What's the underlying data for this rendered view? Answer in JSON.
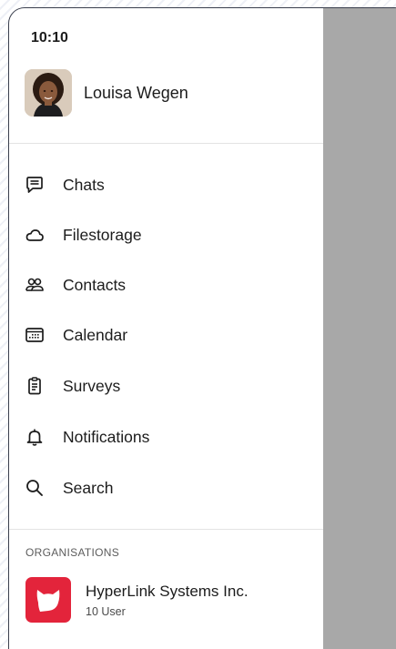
{
  "status_bar": {
    "time": "10:10"
  },
  "profile": {
    "name": "Louisa Wegen"
  },
  "nav": {
    "items": [
      {
        "label": "Chats",
        "icon": "chat-icon"
      },
      {
        "label": "Filestorage",
        "icon": "cloud-icon"
      },
      {
        "label": "Contacts",
        "icon": "contacts-icon"
      },
      {
        "label": "Calendar",
        "icon": "calendar-icon"
      },
      {
        "label": "Surveys",
        "icon": "clipboard-icon"
      },
      {
        "label": "Notifications",
        "icon": "bell-icon"
      },
      {
        "label": "Search",
        "icon": "search-icon"
      }
    ]
  },
  "organisations": {
    "heading": "ORGANISATIONS",
    "items": [
      {
        "name": "HyperLink Systems Inc.",
        "subtitle": "10 User",
        "icon": "cat-logo-icon",
        "color": "#e3243b"
      }
    ]
  },
  "colors": {
    "scrim": "#a8a8a8",
    "drawer": "#ffffff",
    "text": "#1c1c1c",
    "org_brand": "#e3243b"
  }
}
